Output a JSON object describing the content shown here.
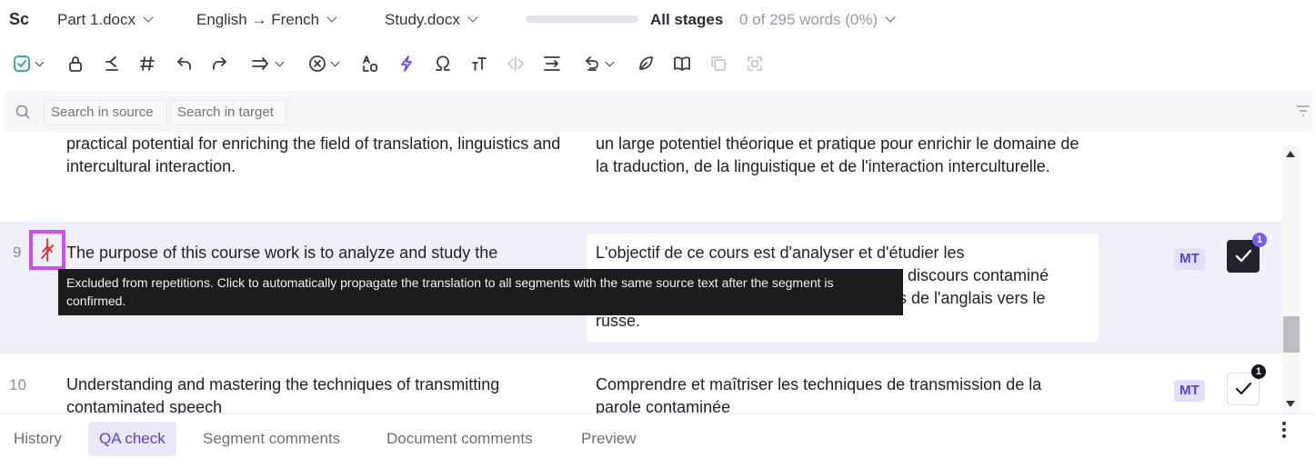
{
  "topbar": {
    "logo": "Sc",
    "file_dropdown": "Part 1.docx",
    "language_dropdown": "English → French",
    "project_dropdown": "Study.docx",
    "progress_percent": 0,
    "stages_label": "All stages",
    "words_status": "0 of 295 words  (0%)"
  },
  "toolbar": {
    "icons": [
      "confirm-icon",
      "lock-icon",
      "copy-source-icon",
      "tags-icon",
      "undo-icon",
      "redo-icon",
      "navigate-next-icon",
      "clear-icon",
      "change-case-icon",
      "pretranslate-icon",
      "special-characters-icon",
      "text-format-icon",
      "code-tags-icon",
      "join-segments-icon",
      "revert-icon",
      "spellcheck-icon",
      "glossary-icon",
      "copy-icon",
      "split-icon"
    ]
  },
  "search": {
    "source_placeholder": "Search in source",
    "target_placeholder": "Search in target"
  },
  "segments": [
    {
      "source": "practical potential for enriching the field of translation, linguistics and intercultural interaction.",
      "target": "un large potentiel théorique et pratique pour enrichir le domaine de la traduction, de la linguistique et de l'interaction interculturelle."
    },
    {
      "number": "9",
      "source": "The purpose of this course work is to analyze and study the",
      "target": "L'objectif de ce cours est d'analyser et d'étudier les discours contaminé ts de l'anglais vers le russe.",
      "target_lines": [
        "L'objectif de ce cours est d'analyser et d'étudier les",
        "discours contaminé",
        "ts de l'anglais vers le",
        "russe."
      ],
      "badge": "MT",
      "comment_count": "1"
    },
    {
      "number": "10",
      "source": "Understanding and mastering the techniques of transmitting contaminated speech",
      "target": "Comprendre et maîtriser les techniques de transmission de la parole contaminée",
      "badge": "MT",
      "comment_count": "1"
    }
  ],
  "tooltip": "Excluded from repetitions. Click to automatically propagate the translation to all segments with the same source text after the segment is confirmed.",
  "bottom_tabs": [
    "History",
    "QA check",
    "Segment comments",
    "Document comments",
    "Preview"
  ],
  "active_tab": "QA check",
  "colors": {
    "accent": "#7a5cf5",
    "highlight": "#d14cf2",
    "active_row": "#efeff9",
    "repetition_icon": "#e0322b"
  }
}
